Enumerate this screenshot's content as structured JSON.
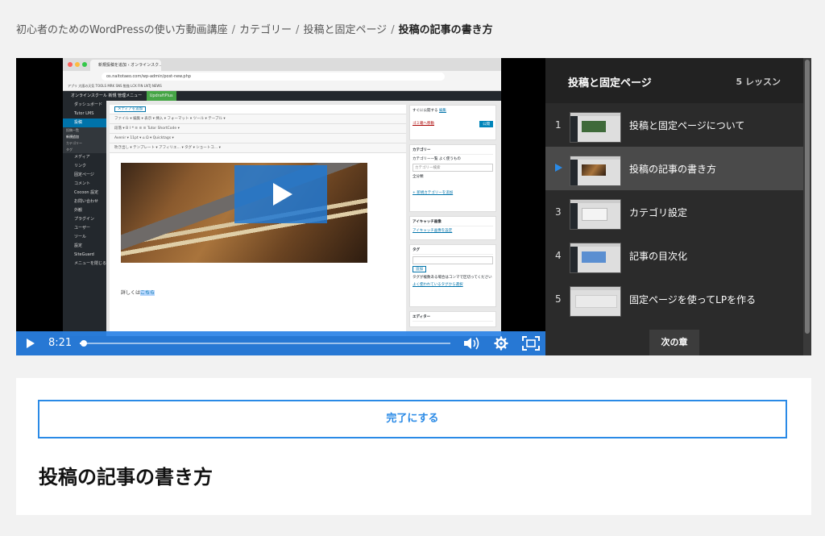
{
  "breadcrumb": {
    "items": [
      "初心者のためのWordPressの使い方動画講座",
      "カテゴリー",
      "投稿と固定ページ"
    ],
    "current": "投稿の記事の書き方",
    "separator": "/"
  },
  "video": {
    "time": "8:21",
    "progress": 0.01,
    "screen": {
      "tab_title": "新規投稿を追加 ‹ オンラインスク…",
      "url": "os.naitotaeo.com/wp-admin/post-new.php",
      "bookmarks": "アプリ  大阪の天気  TOOLS  MRK  SNS  勉強  LCK  FIN  LNTJ  NEWS",
      "adminbar": "オンラインスクール  新規  管理メニュー",
      "adminbar_plugin": "UpdraftPlus",
      "sidebar": [
        "ダッシュボード",
        "Tutor LMS",
        "投稿",
        "投稿一覧",
        "新規追加",
        "カテゴリー",
        "タグ",
        "メディア",
        "リンク",
        "固定ページ",
        "コメント",
        "Cocoon 設定",
        "お問い合わせ",
        "外観",
        "プラグイン",
        "ユーザー",
        "ツール",
        "設定",
        "SiteGuard",
        "メニューを閉じる"
      ],
      "toolbar1": "メディアを追加",
      "toolbar2": "ファイル ▾  編集 ▾  表示 ▾  挿入 ▾  フォーマット ▾  ツール ▾  テーブル ▾",
      "toolbar3": "段落 ▾   B  I  ❝  ≡  ≡  ≡  Tutor ShortCode ▾",
      "toolbar4": "Avenir ▾  11pt ▾   ⌂  Ω  ▾  Quicktags ▾",
      "toolbar5": "吹き出し ▾  テンプレート ▾  アフィリエ… ▾  タグ ▾  ショートコ… ▾",
      "editor_text": "詳しくは",
      "editor_link": "こちら",
      "meta_publish": "すぐに公開する",
      "meta_publish_edit": "編集",
      "meta_trash": "ゴミ箱へ移動",
      "meta_publish_btn": "公開",
      "meta_category": "カテゴリー",
      "meta_category_tabs": "カテゴリー一覧   よく使うもの",
      "meta_category_search": "カテゴリー検索",
      "meta_category_all": "全分類",
      "meta_category_add": "+ 新規カテゴリーを追加",
      "meta_eyecatch": "アイキャッチ画像",
      "meta_eyecatch_link": "アイキャッチ画像を設定",
      "meta_tag": "タグ",
      "meta_tag_add": "追加",
      "meta_tag_help": "タグが複数ある場合はコンマで区切ってください",
      "meta_tag_popular": "よく使われているタグから選択",
      "meta_editor": "エディター"
    }
  },
  "playlist": {
    "title": "投稿と固定ページ",
    "count": "5 レッスン",
    "items": [
      {
        "num": "1",
        "label": "投稿と固定ページについて",
        "active": false
      },
      {
        "num": "",
        "label": "投稿の記事の書き方",
        "active": true
      },
      {
        "num": "3",
        "label": "カテゴリ設定",
        "active": false
      },
      {
        "num": "4",
        "label": "記事の目次化",
        "active": false
      },
      {
        "num": "5",
        "label": "固定ページを使ってLPを作る",
        "active": false
      }
    ],
    "next_label": "次の章"
  },
  "lesson": {
    "complete_label": "完了にする",
    "title": "投稿の記事の書き方"
  },
  "colors": {
    "accent": "#2a8ae6",
    "playlist_bg": "#2b2b2b",
    "playlist_active": "#4a4a4a"
  }
}
